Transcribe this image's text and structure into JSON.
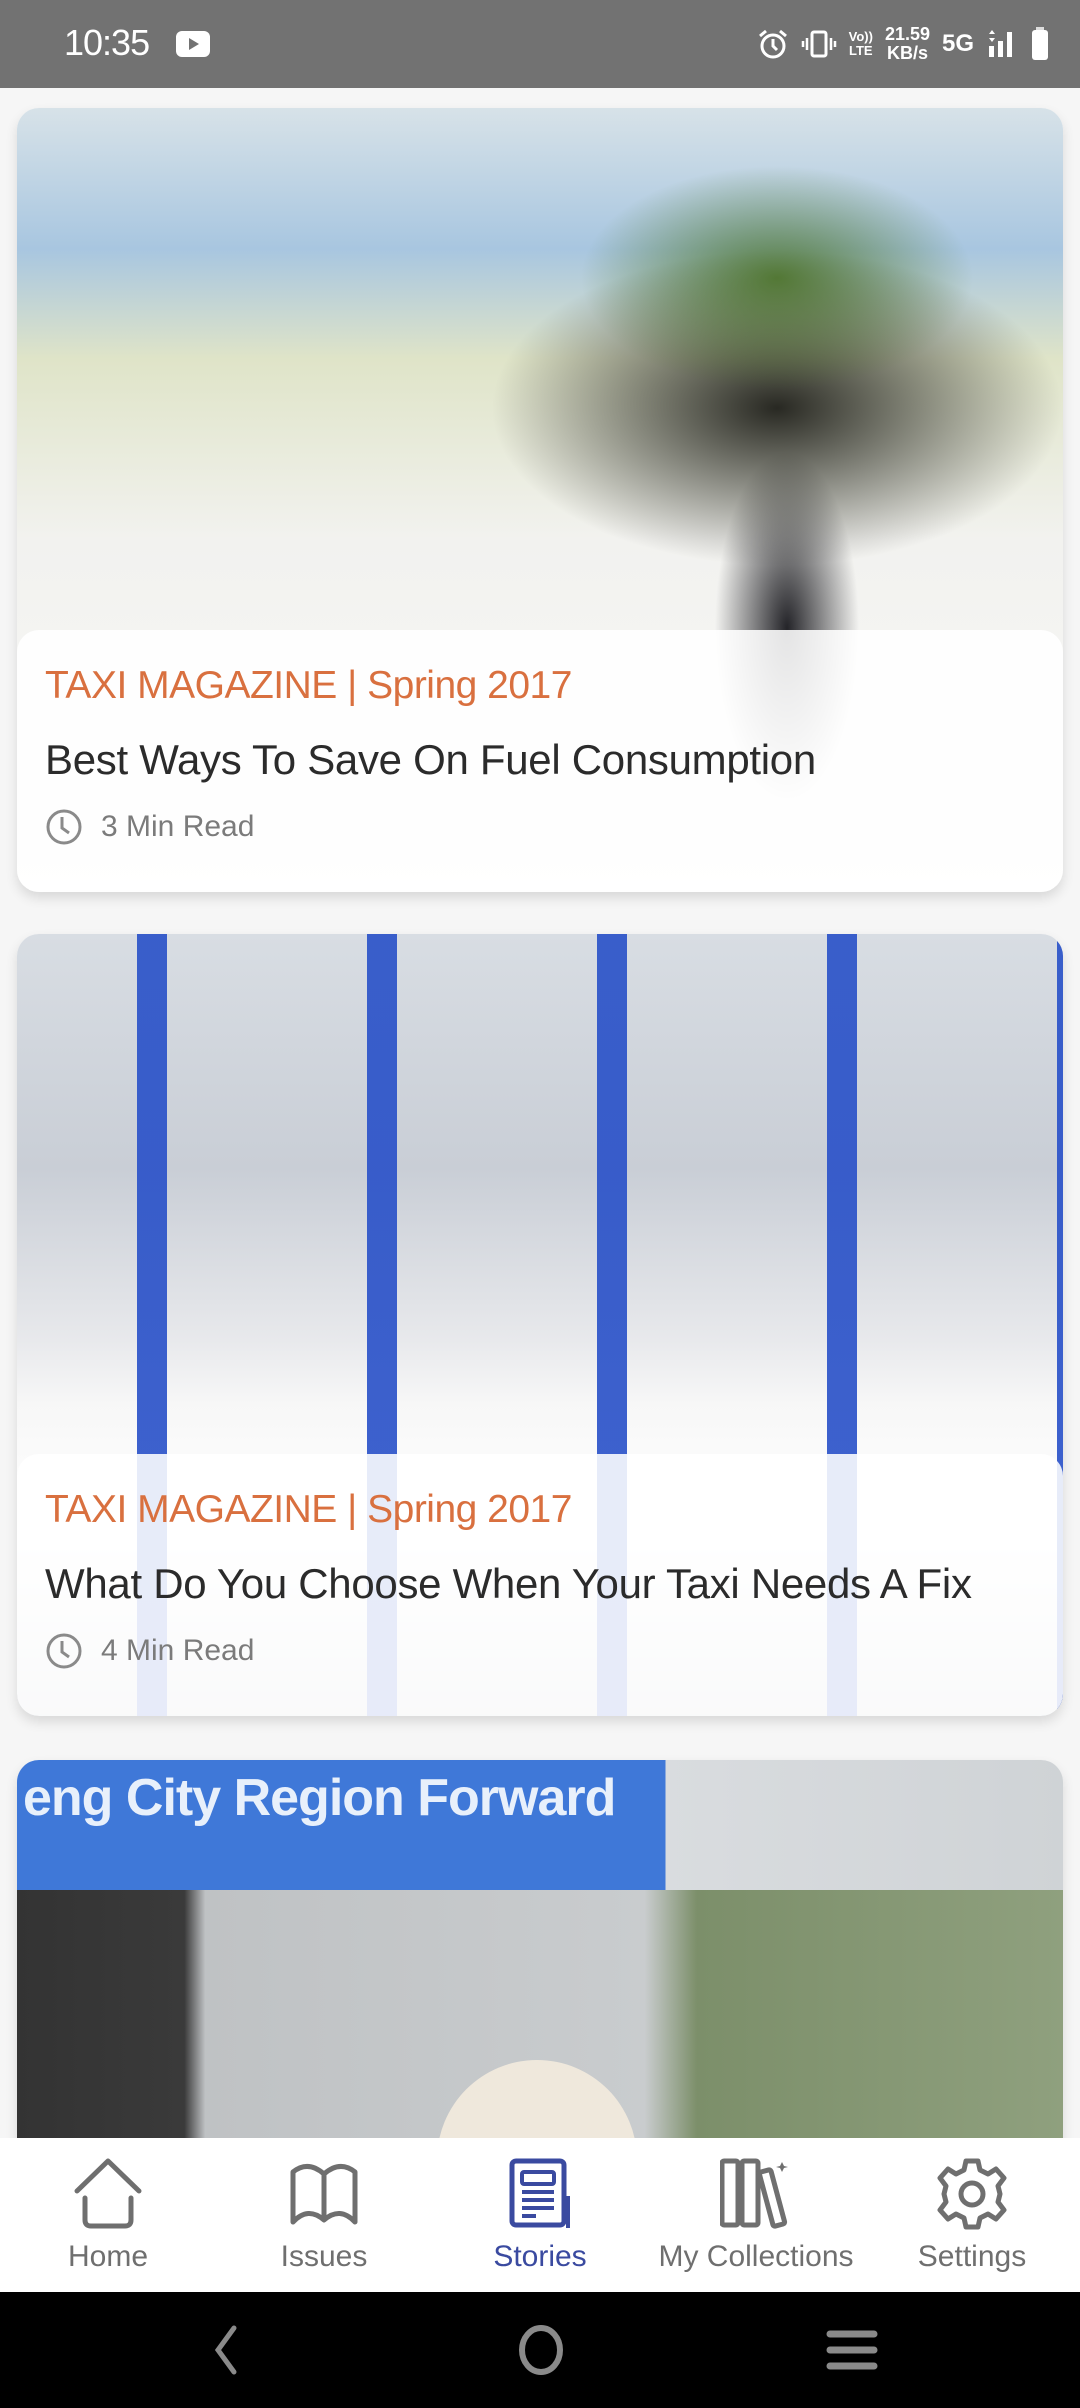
{
  "status_bar": {
    "time": "10:35",
    "notification_icons": [
      "youtube-icon"
    ],
    "system_icons": [
      "alarm-icon",
      "vibrate-icon",
      "volte-icon",
      "signal-icon",
      "battery-icon"
    ],
    "volte_top": "Vo))",
    "volte_bottom": "LTE",
    "net_speed_value": "21.59",
    "net_speed_unit": "KB/s",
    "network_type": "5G"
  },
  "stories": [
    {
      "magazine": "TAXI MAGAZINE | Spring 2017",
      "title": "Best Ways To Save On Fuel Consumption",
      "read_time": "3 Min Read",
      "image": "fuel-pour-road-image"
    },
    {
      "magazine": "TAXI MAGAZINE | Spring 2017",
      "title": "What Do You Choose When Your Taxi Needs A Fix",
      "read_time": "4 Min Read",
      "image": "taxi-workshop-image"
    },
    {
      "image": "city-region-sign-image",
      "image_text": "eng City Region Forward"
    }
  ],
  "tab_bar": {
    "active": "Stories",
    "active_color": "#3a4aa0",
    "items": [
      {
        "label": "Home",
        "icon": "home-icon"
      },
      {
        "label": "Issues",
        "icon": "book-icon"
      },
      {
        "label": "Stories",
        "icon": "stories-icon"
      },
      {
        "label": "My Collections",
        "icon": "collections-icon"
      },
      {
        "label": "Settings",
        "icon": "gear-icon"
      }
    ]
  },
  "nav_bar": {
    "buttons": [
      "back",
      "home",
      "recents"
    ]
  },
  "colors": {
    "accent_orange": "#d9703f",
    "status_bar_bg": "#727272"
  }
}
